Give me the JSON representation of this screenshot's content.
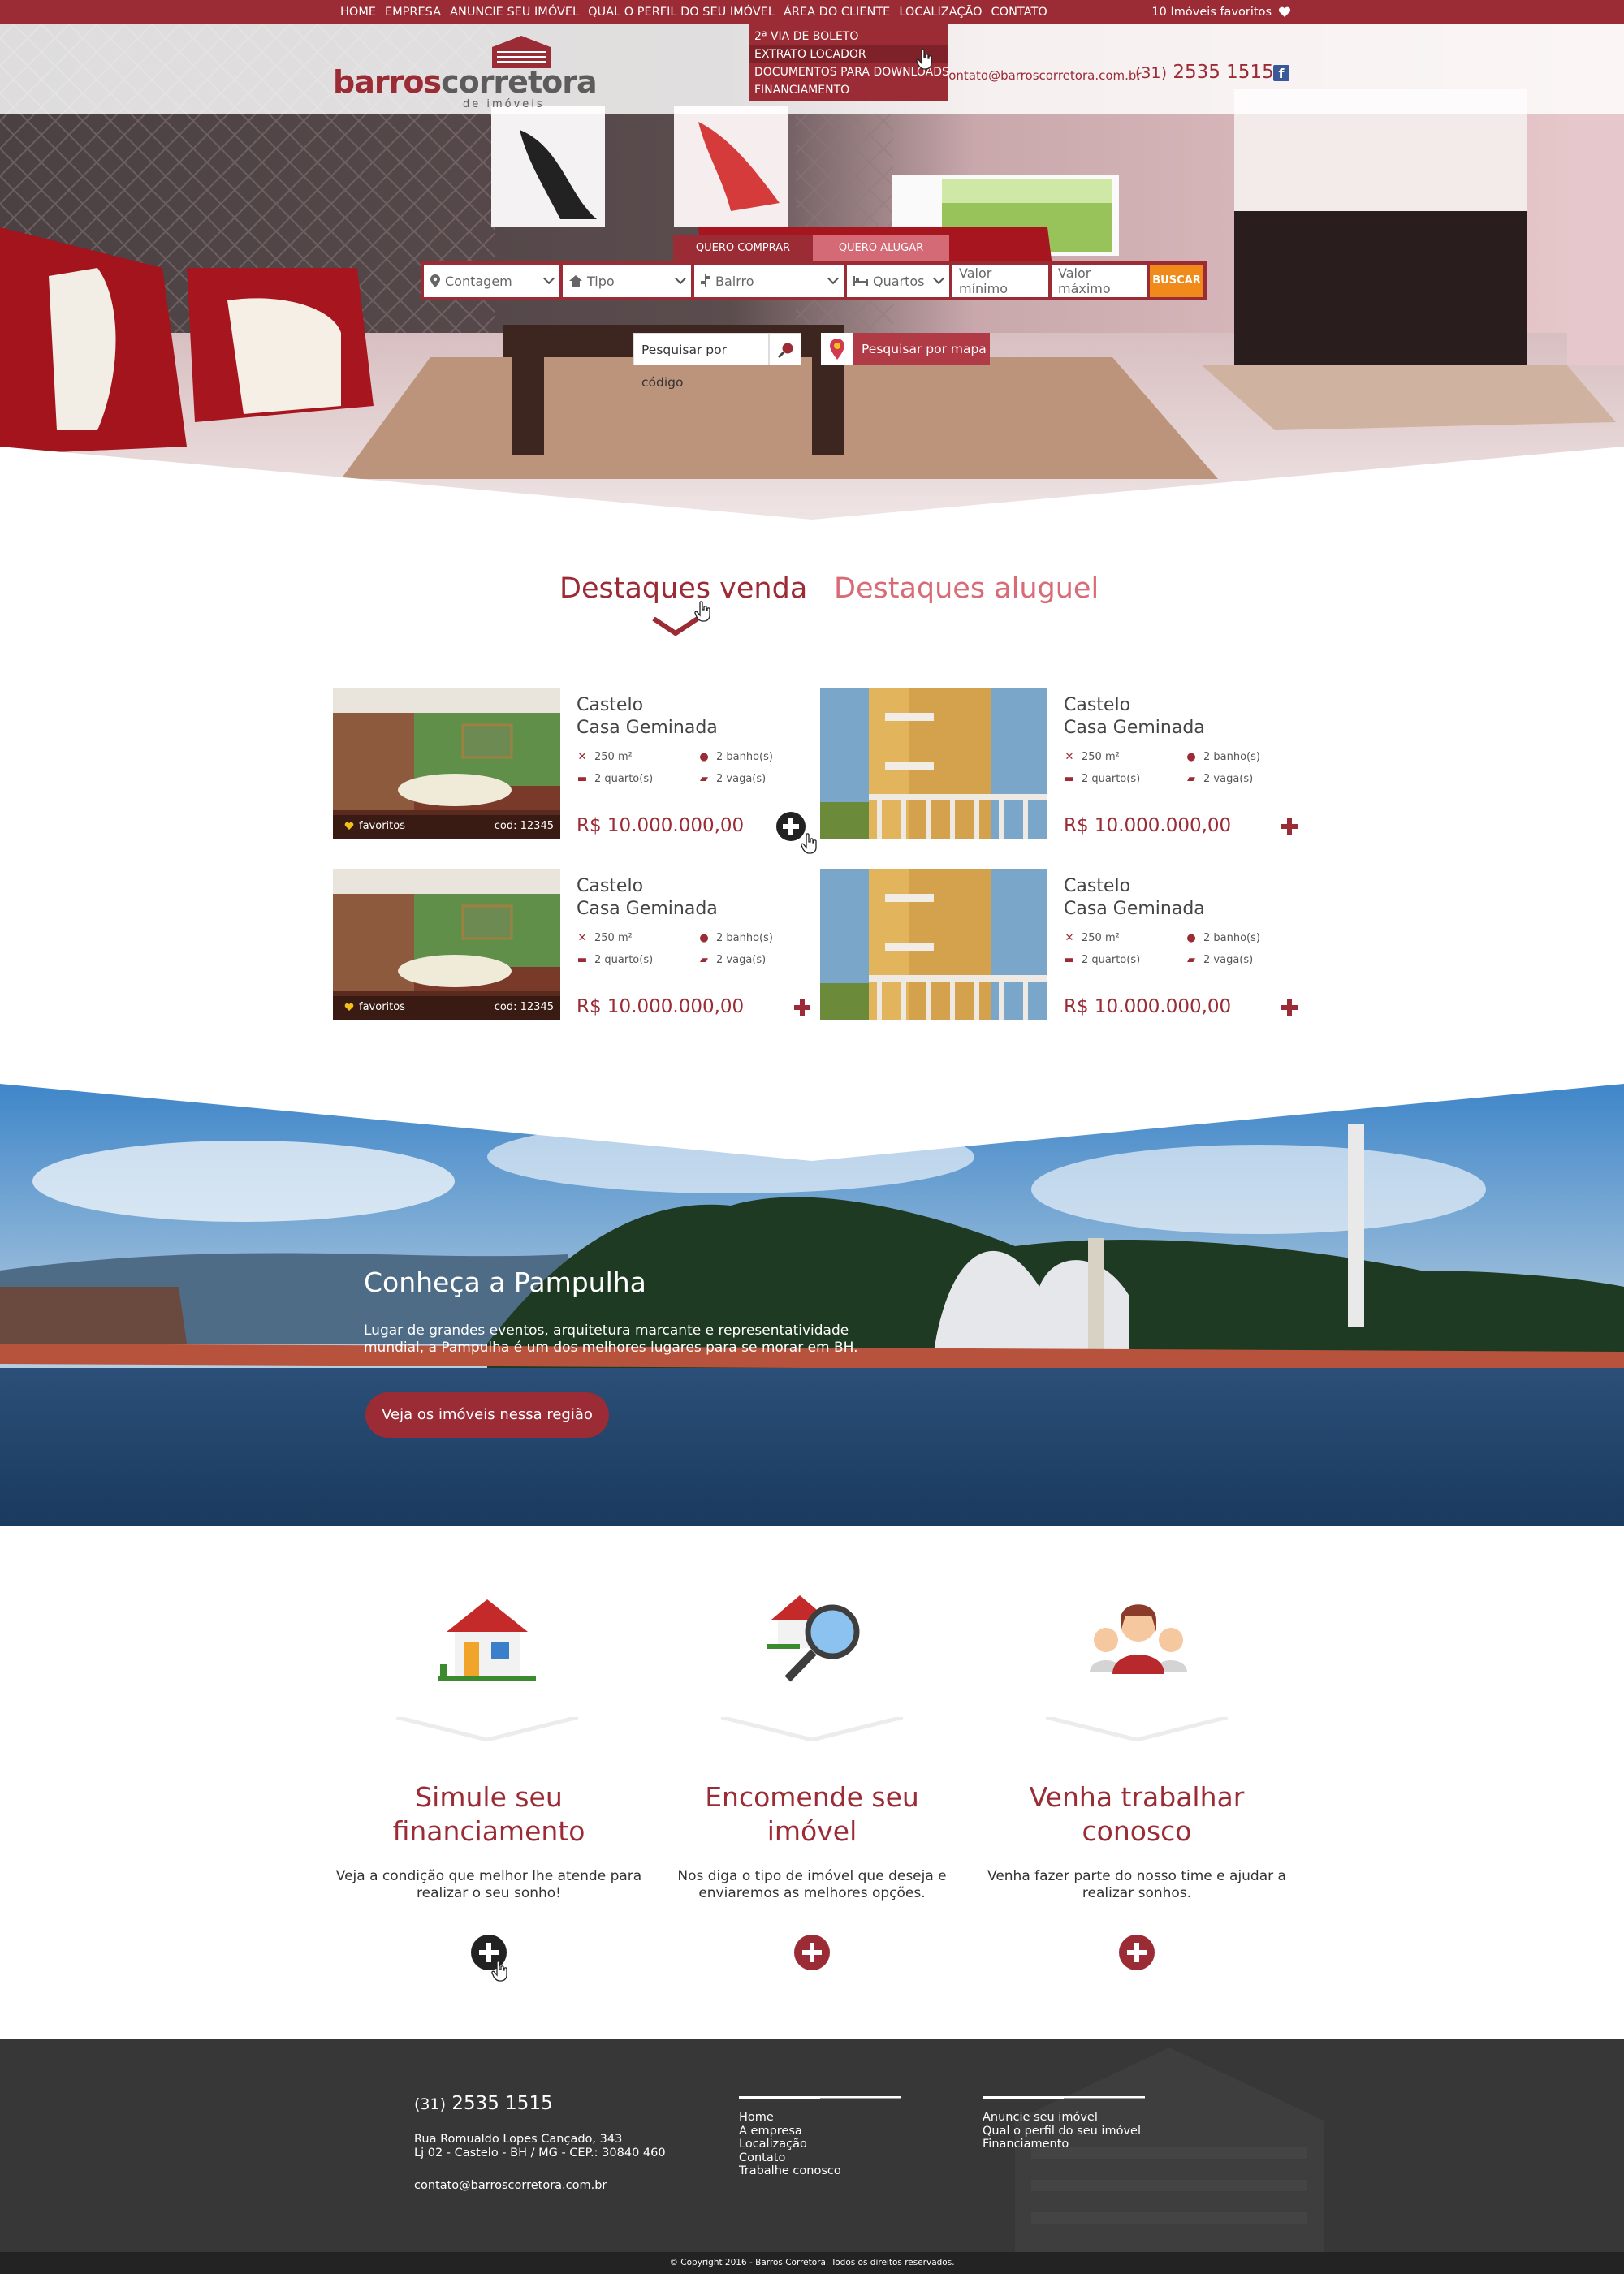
{
  "topnav": {
    "items": [
      "HOME",
      "EMPRESA",
      "ANUNCIE SEU IMÓVEL",
      "QUAL O PERFIL DO SEU IMÓVEL",
      "ÁREA DO CLIENTE",
      "LOCALIZAÇÃO",
      "CONTATO"
    ],
    "favorites": "10 Imóveis favoritos",
    "dropdown": [
      "2ª VIA DE BOLETO",
      "EXTRATO LOCADOR",
      "DOCUMENTOS PARA DOWNLOADS",
      "FINANCIAMENTO"
    ]
  },
  "header": {
    "logo_part1": "barros",
    "logo_part2": "corretora",
    "logo_sub": "de imóveis",
    "email": "contato@barroscorretora.com.br",
    "phone_prefix": "(31)",
    "phone": "2535 1515"
  },
  "search": {
    "tab_buy": "QUERO COMPRAR",
    "tab_rent": "QUERO ALUGAR",
    "city": "Contagem",
    "type": "Tipo",
    "district": "Bairro",
    "rooms": "Quartos",
    "min_value": "Valor mínimo",
    "max_value": "Valor máximo",
    "submit": "BUSCAR",
    "code_search": "Pesquisar por código",
    "map_search": "Pesquisar por mapa"
  },
  "highlights": {
    "tab_sale": "Destaques venda",
    "tab_rent": "Destaques aluguel",
    "cards": [
      {
        "location": "Castelo",
        "type": "Casa Geminada",
        "area": "250 m²",
        "baths": "2 banho(s)",
        "rooms": "2 quarto(s)",
        "garage": "2 vaga(s)",
        "price": "R$ 10.000.000,00",
        "fav": "favoritos",
        "code": "cod: 12345"
      },
      {
        "location": "Castelo",
        "type": "Casa Geminada",
        "area": "250 m²",
        "baths": "2 banho(s)",
        "rooms": "2 quarto(s)",
        "garage": "2 vaga(s)",
        "price": "R$ 10.000.000,00"
      },
      {
        "location": "Castelo",
        "type": "Casa Geminada",
        "area": "250 m²",
        "baths": "2 banho(s)",
        "rooms": "2 quarto(s)",
        "garage": "2 vaga(s)",
        "price": "R$ 10.000.000,00",
        "fav": "favoritos",
        "code": "cod: 12345"
      },
      {
        "location": "Castelo",
        "type": "Casa Geminada",
        "area": "250 m²",
        "baths": "2 banho(s)",
        "rooms": "2 quarto(s)",
        "garage": "2 vaga(s)",
        "price": "R$ 10.000.000,00"
      }
    ]
  },
  "pampulha": {
    "title": "Conheça a Pampulha",
    "description": "Lugar de grandes eventos, arquitetura marcante e representatividade mundial, a Pampulha é um dos melhores lugares para se morar em BH.",
    "button": "Veja os imóveis nessa região"
  },
  "features": [
    {
      "title": "Simule seu financiamento",
      "description": "Veja a condição que melhor lhe atende para realizar o seu sonho!"
    },
    {
      "title": "Encomende seu imóvel",
      "description": "Nos diga o tipo de imóvel que deseja e enviaremos as melhores opções."
    },
    {
      "title": "Venha trabalhar conosco",
      "description": "Venha fazer parte do nosso time e ajudar a realizar sonhos."
    }
  ],
  "footer": {
    "phone_prefix": "(31)",
    "phone": "2535 1515",
    "address_line1": "Rua Romualdo Lopes Cançado, 343",
    "address_line2": "Lj 02 - Castelo - BH / MG - CEP.: 30840 460",
    "email": "contato@barroscorretora.com.br",
    "links1": [
      "Home",
      "A empresa",
      "Localização",
      "Contato",
      "Trabalhe conosco"
    ],
    "links2": [
      "Anuncie seu imóvel",
      "Qual o perfil do seu imóvel",
      "Financiamento"
    ],
    "copyright": "© Copyright 2016 - Barros Corretora. Todos os direitos reservados."
  },
  "colors": {
    "brand": "#9b2b35",
    "accent_orange": "#f08b1b",
    "footer": "#373737"
  }
}
